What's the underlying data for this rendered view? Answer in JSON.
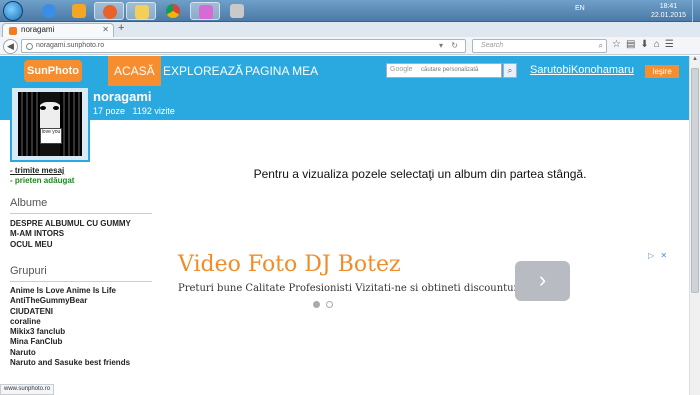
{
  "taskbar": {
    "language": "EN",
    "time": "18:41",
    "date": "22.01.2015"
  },
  "browser": {
    "tab_title": "noragami",
    "new_tab": "+",
    "url": "noragami.sunphoto.ro",
    "search_placeholder": "Search",
    "status_url": "www.sunphoto.ro"
  },
  "site": {
    "logo": "SunPhoto",
    "nav": [
      "ACASĂ",
      "EXPLOREAZĂ",
      "PAGINA MEA"
    ],
    "search_brand": "Google",
    "search_placeholder": "căutare personalizată",
    "username": "SarutobiKonohamaru",
    "logout": "Ieşire"
  },
  "album": {
    "name": "noragami",
    "photos": "17 poze",
    "visits": "1192 vizite",
    "avatar_sign": "love you"
  },
  "sidebar": {
    "send_message": "- trimite mesaj",
    "friend_added": "- prieten adăugat",
    "albums_title": "Albume",
    "albums": [
      "DESPRE ALBUMUL CU GUMMY",
      "M-AM INTORS",
      "OCUL MEU"
    ],
    "groups_title": "Grupuri",
    "groups": [
      "Anime Is Love Anime Is Life",
      "AntiTheGummyBear",
      "CIUDATENI",
      "coraline",
      "Mikix3 fanclub",
      "Mina FanClub",
      "Naruto",
      "Naruto and Sasuke best friends"
    ]
  },
  "main": {
    "message": "Pentru a vizualiza pozele selectaţi un album din partea stângă."
  },
  "ad": {
    "title": "Video Foto DJ Botez",
    "description": "Preturi bune Calitate Profesionisti Vizitati-ne si obtineti discounturi",
    "button": "›",
    "adchoices": "▷ ✕"
  }
}
